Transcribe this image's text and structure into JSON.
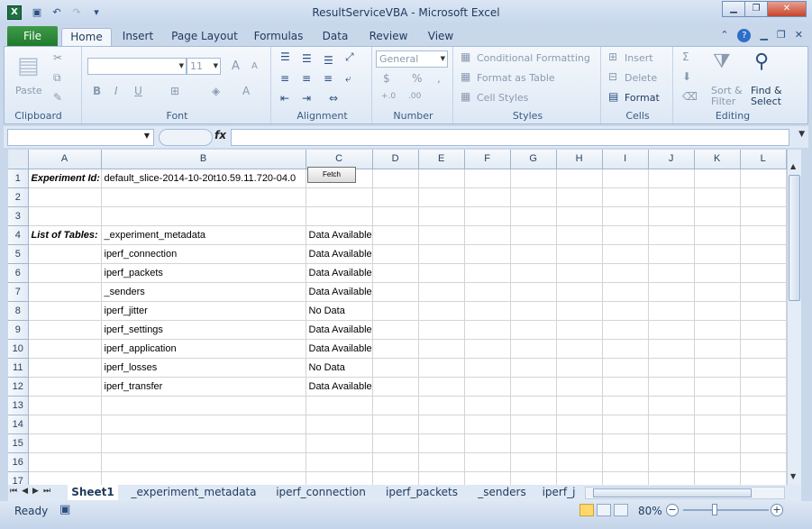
{
  "window": {
    "title": "ResultServiceVBA  -  Microsoft Excel",
    "app_icon": "X"
  },
  "ribbon_tabs": {
    "file": "File",
    "home": "Home",
    "insert": "Insert",
    "page_layout": "Page Layout",
    "formulas": "Formulas",
    "data": "Data",
    "review": "Review",
    "view": "View"
  },
  "ribbon": {
    "clipboard": {
      "label": "Clipboard",
      "paste": "Paste"
    },
    "font": {
      "label": "Font",
      "size": "11",
      "bold": "B",
      "italic": "I",
      "underline": "U",
      "grow": "A",
      "shrink": "A"
    },
    "alignment": {
      "label": "Alignment"
    },
    "number": {
      "label": "Number",
      "format": "General",
      "currency": "$",
      "percent": "%",
      "comma": ","
    },
    "styles": {
      "label": "Styles",
      "conditional": "Conditional Formatting",
      "format_table": "Format as Table",
      "cell_styles": "Cell Styles"
    },
    "cells": {
      "label": "Cells",
      "insert": "Insert",
      "delete": "Delete",
      "format": "Format"
    },
    "editing": {
      "label": "Editing",
      "sigma": "Σ",
      "sort": "Sort &",
      "filter": "Filter",
      "find": "Find &",
      "select": "Select"
    }
  },
  "formula_bar": {
    "name_box": "",
    "fx": "fx",
    "formula": ""
  },
  "columns": [
    "A",
    "B",
    "C",
    "D",
    "E",
    "F",
    "G",
    "H",
    "I",
    "J",
    "K",
    "L"
  ],
  "rows": [
    {
      "n": "1",
      "a": "Experiment Id:",
      "b": "default_slice-2014-10-20t10.59.11.720-04.0",
      "c": ""
    },
    {
      "n": "2",
      "a": "",
      "b": "",
      "c": ""
    },
    {
      "n": "3",
      "a": "",
      "b": "",
      "c": ""
    },
    {
      "n": "4",
      "a": "List of Tables:",
      "b": "_experiment_metadata",
      "c": "Data Available"
    },
    {
      "n": "5",
      "a": "",
      "b": "iperf_connection",
      "c": "Data Available"
    },
    {
      "n": "6",
      "a": "",
      "b": "iperf_packets",
      "c": "Data Available"
    },
    {
      "n": "7",
      "a": "",
      "b": "_senders",
      "c": "Data Available"
    },
    {
      "n": "8",
      "a": "",
      "b": "iperf_jitter",
      "c": "No Data"
    },
    {
      "n": "9",
      "a": "",
      "b": "iperf_settings",
      "c": "Data Available"
    },
    {
      "n": "10",
      "a": "",
      "b": "iperf_application",
      "c": "Data Available"
    },
    {
      "n": "11",
      "a": "",
      "b": "iperf_losses",
      "c": "No Data"
    },
    {
      "n": "12",
      "a": "",
      "b": "iperf_transfer",
      "c": "Data Available"
    },
    {
      "n": "13",
      "a": "",
      "b": "",
      "c": ""
    },
    {
      "n": "14",
      "a": "",
      "b": "",
      "c": ""
    },
    {
      "n": "15",
      "a": "",
      "b": "",
      "c": ""
    },
    {
      "n": "16",
      "a": "",
      "b": "",
      "c": ""
    },
    {
      "n": "17",
      "a": "",
      "b": "",
      "c": ""
    }
  ],
  "fetch_button": "Fetch",
  "sheet_tabs": [
    "Sheet1",
    "_experiment_metadata",
    "iperf_connection",
    "iperf_packets",
    "_senders",
    "iperf_j"
  ],
  "status": {
    "text": "Ready",
    "zoom": "80%"
  }
}
